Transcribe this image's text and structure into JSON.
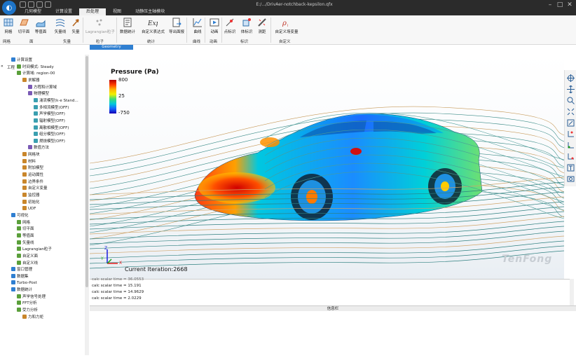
{
  "window": {
    "title": "E:/.../DrivAer-notchback-kepsilon.qfx"
  },
  "menu_tabs": [
    "几何模型",
    "计算设置",
    "后处理",
    "视图",
    "动静压主轴模块"
  ],
  "ribbon": {
    "buttons": [
      "网格",
      "切平面",
      "等值面",
      "矢量线",
      "矢量",
      "Lagrangian粒子",
      "数据统计",
      "自定义表达式",
      "导出面报",
      "曲线",
      "动画",
      "点标识",
      "体标识",
      "测距",
      "自定义场变量"
    ],
    "groups": [
      "网格",
      "面",
      "矢量",
      "粒子",
      "统计",
      "曲线",
      "动画",
      "标识",
      "自定义"
    ],
    "context_tab": "Geometry"
  },
  "tree": {
    "header": "工程",
    "nodes": [
      {
        "label": "计算设置",
        "level": 0
      },
      {
        "label": "时间模式: Steady",
        "level": 1
      },
      {
        "label": "计算域: region-00",
        "level": 1
      },
      {
        "label": "求解器",
        "level": 2
      },
      {
        "label": "方程和计算域",
        "level": 3
      },
      {
        "label": "物理模型",
        "level": 3
      },
      {
        "label": "湍流模型(k-e Stand...",
        "level": 4
      },
      {
        "label": "多相流模型(OFF)",
        "level": 4
      },
      {
        "label": "声学模型(OFF)",
        "level": 4
      },
      {
        "label": "辐射模型(OFF)",
        "level": 4
      },
      {
        "label": "离散相模型(OFF)",
        "level": 4
      },
      {
        "label": "组分模型(OFF)",
        "level": 4
      },
      {
        "label": "燃烧模型(OFF)",
        "level": 4
      },
      {
        "label": "数值方法",
        "level": 3
      },
      {
        "label": "网格块",
        "level": 2
      },
      {
        "label": "材料",
        "level": 2
      },
      {
        "label": "附加模型",
        "level": 2
      },
      {
        "label": "运动属性",
        "level": 2
      },
      {
        "label": "边界条件",
        "level": 2
      },
      {
        "label": "自定义变量",
        "level": 2
      },
      {
        "label": "监控器",
        "level": 2
      },
      {
        "label": "初始化",
        "level": 2
      },
      {
        "label": "UDF",
        "level": 2
      },
      {
        "label": "可视化",
        "level": 0
      },
      {
        "label": "网格",
        "level": 1
      },
      {
        "label": "切平面",
        "level": 1
      },
      {
        "label": "等值面",
        "level": 1
      },
      {
        "label": "矢量线",
        "level": 1
      },
      {
        "label": "Lagrangian粒子",
        "level": 1
      },
      {
        "label": "自定义面",
        "level": 1
      },
      {
        "label": "自定义线",
        "level": 1
      },
      {
        "label": "窗口管理",
        "level": 0
      },
      {
        "label": "数据集",
        "level": 0
      },
      {
        "label": "Turbo-Post",
        "level": 0
      },
      {
        "label": "数据统计",
        "level": 0
      },
      {
        "label": "声学信号处理",
        "level": 1
      },
      {
        "label": "FFT分析",
        "level": 1
      },
      {
        "label": "受力分析",
        "level": 1
      },
      {
        "label": "力和力矩",
        "level": 2
      }
    ]
  },
  "viewport": {
    "legend_title": "Pressure (Pa)",
    "legend_max": "800",
    "legend_mid": "25",
    "legend_min": "-750",
    "iteration": "Current Iteration:2668",
    "brand": "TenFong",
    "axis_x": "X",
    "axis_y": "Y",
    "axis_z": "Z"
  },
  "console": {
    "lines": [
      "calc scalar time = 36.0553",
      "calc scalar time = 15.191",
      "calc scalar time = 14.9629",
      "calc scalar time = 2.0229"
    ]
  },
  "info_bar": "信息栏",
  "colors": {
    "accent": "#2f7fd1",
    "titlebar": "#2b2b2b"
  }
}
